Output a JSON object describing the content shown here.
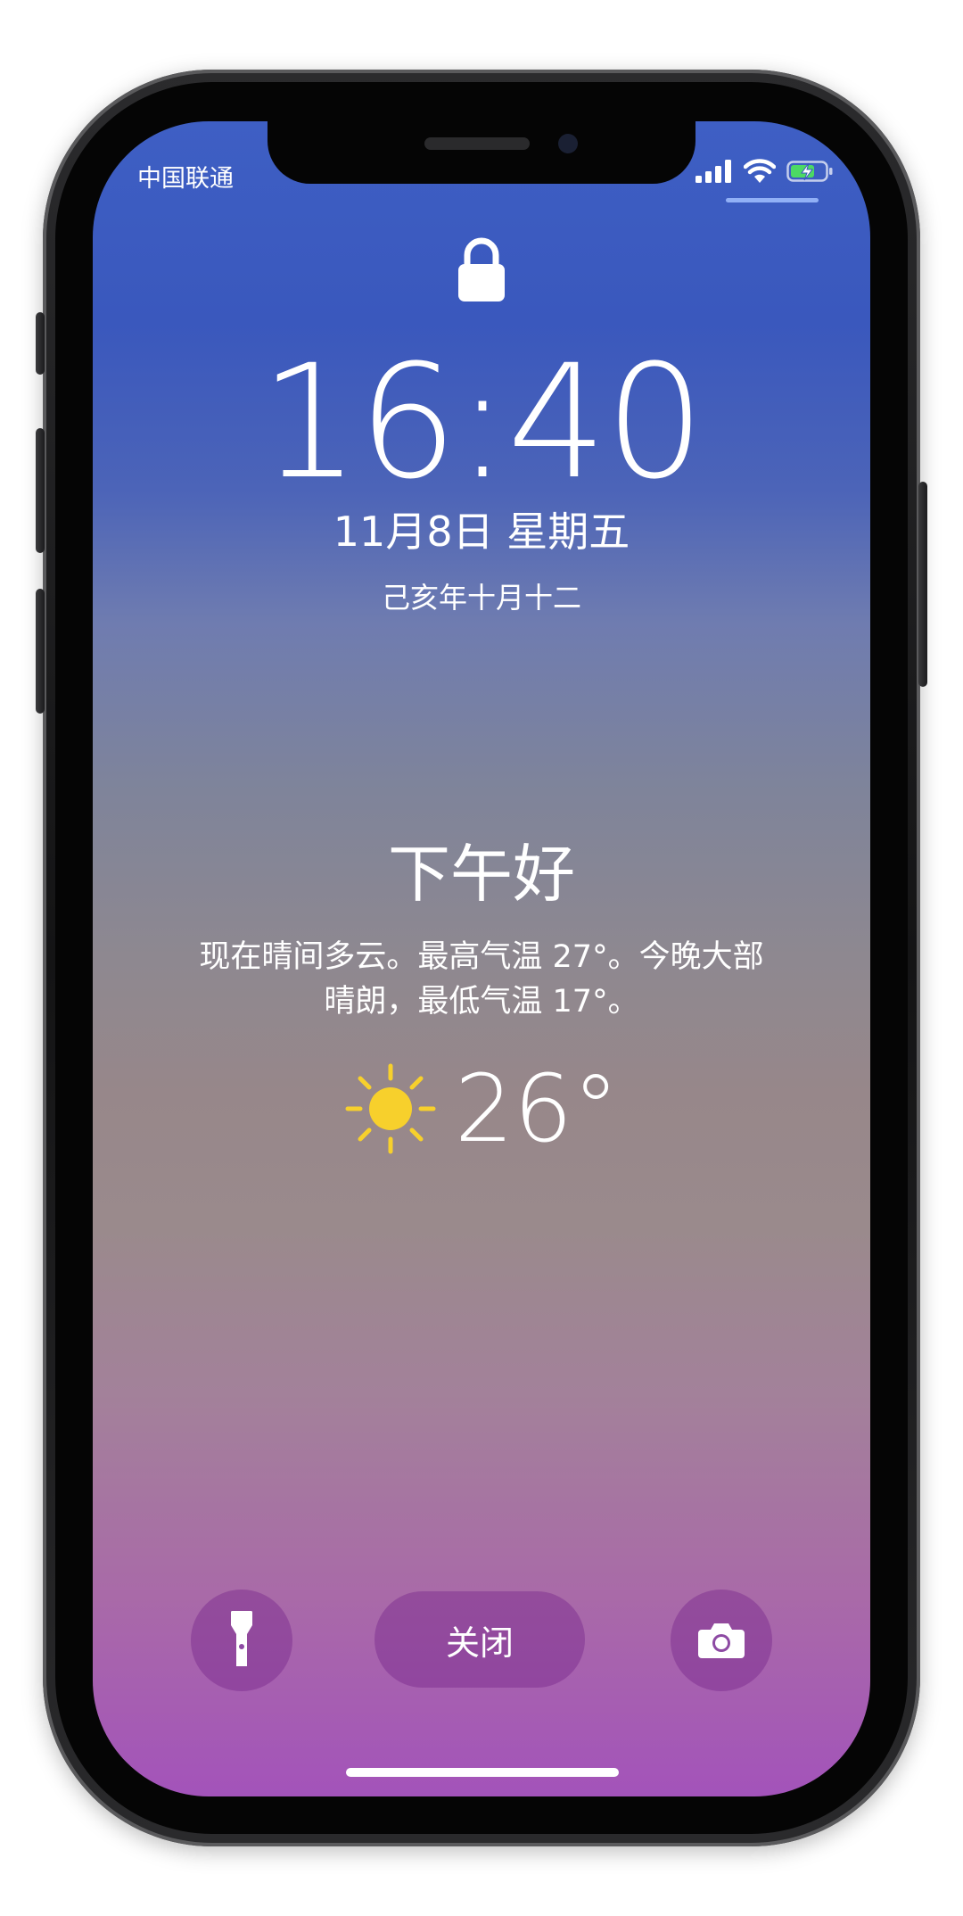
{
  "status_bar": {
    "carrier": "中国联通",
    "signal_icon": "cellular-signal-icon",
    "wifi_icon": "wifi-icon",
    "battery_icon": "battery-charging-icon",
    "battery_color": "#4cd964"
  },
  "lock_screen": {
    "lock_icon": "lock-icon",
    "time": "16:40",
    "date": "11月8日 星期五",
    "lunar_date": "己亥年十月十二"
  },
  "weather_widget": {
    "greeting": "下午好",
    "forecast_line1": "现在晴间多云。最高气温 27°。今晚大部",
    "forecast_line2": "晴朗，最低气温 17°。",
    "condition_icon": "sun-icon",
    "sun_color": "#f7d02c",
    "temperature": "26°"
  },
  "quick_actions": {
    "flashlight_icon": "flashlight-icon",
    "dismiss_label": "关闭",
    "camera_icon": "camera-icon"
  }
}
